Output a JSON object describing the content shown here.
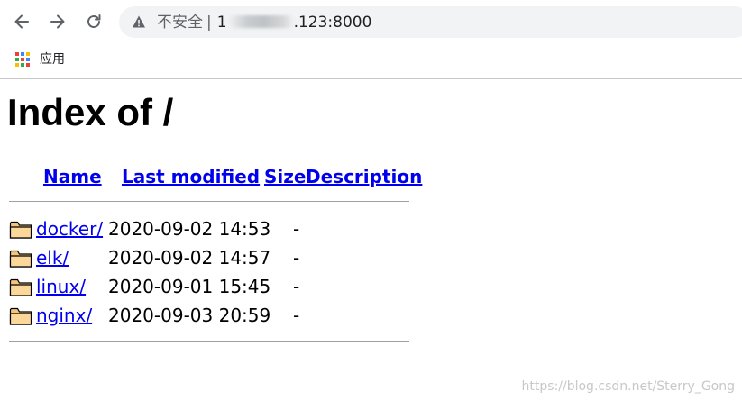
{
  "browser": {
    "security_label": "不安全",
    "separator": "|",
    "url_prefix": "1",
    "url_suffix": ".123:8000",
    "bookmarks_bar": {
      "apps_label": "应用"
    },
    "icons": {
      "back": "arrow-left-icon",
      "forward": "arrow-right-icon",
      "reload": "reload-icon",
      "security": "warning-triangle-icon",
      "apps": "apps-grid-icon"
    }
  },
  "page": {
    "title": "Index of /",
    "columns": {
      "name": "Name",
      "last_modified": "Last modified",
      "size": "Size",
      "description": "Description"
    },
    "entries": [
      {
        "name": "docker/",
        "modified": "2020-09-02 14:53",
        "size": "-"
      },
      {
        "name": "elk/",
        "modified": "2020-09-02 14:57",
        "size": "-"
      },
      {
        "name": "linux/",
        "modified": "2020-09-01 15:45",
        "size": "-"
      },
      {
        "name": "nginx/",
        "modified": "2020-09-03 20:59",
        "size": "-"
      }
    ],
    "link_color": "#0000ee"
  },
  "watermark": "https://blog.csdn.net/Sterry_Gong"
}
